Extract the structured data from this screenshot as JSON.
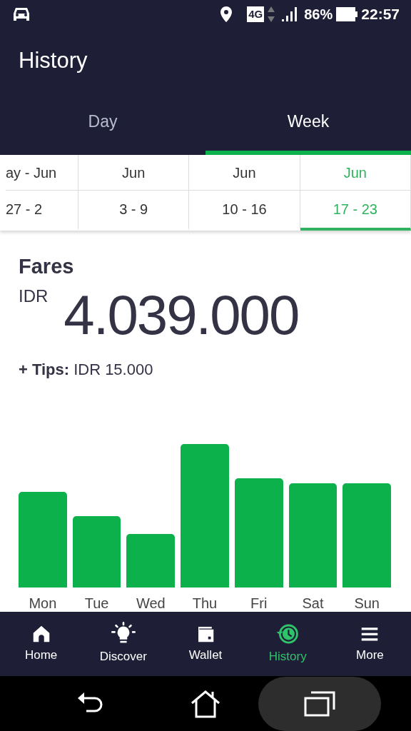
{
  "status_bar": {
    "network": "4G",
    "battery": "86%",
    "time": "22:57"
  },
  "header": {
    "title": "History"
  },
  "tabs": [
    {
      "label": "Day",
      "selected": false
    },
    {
      "label": "Week",
      "selected": true
    }
  ],
  "weeks": [
    {
      "month": "ay - Jun",
      "range": "27 - 2",
      "selected": false
    },
    {
      "month": "Jun",
      "range": "3 - 9",
      "selected": false
    },
    {
      "month": "Jun",
      "range": "10 - 16",
      "selected": false
    },
    {
      "month": "Jun",
      "range": "17 - 23",
      "selected": true
    }
  ],
  "fares": {
    "title": "Fares",
    "currency": "IDR",
    "amount": "4.039.000",
    "tips_label": "+ Tips:",
    "tips_value": "IDR 15.000"
  },
  "days": [
    "Mon",
    "Tue",
    "Wed",
    "Thu",
    "Fri",
    "Sat",
    "Sun"
  ],
  "nav": [
    {
      "label": "Home",
      "kind": "home",
      "selected": false
    },
    {
      "label": "Discover",
      "kind": "bulb",
      "selected": false
    },
    {
      "label": "Wallet",
      "kind": "wallet",
      "selected": false
    },
    {
      "label": "History",
      "kind": "history",
      "selected": true
    },
    {
      "label": "More",
      "kind": "menu",
      "selected": false
    }
  ]
}
